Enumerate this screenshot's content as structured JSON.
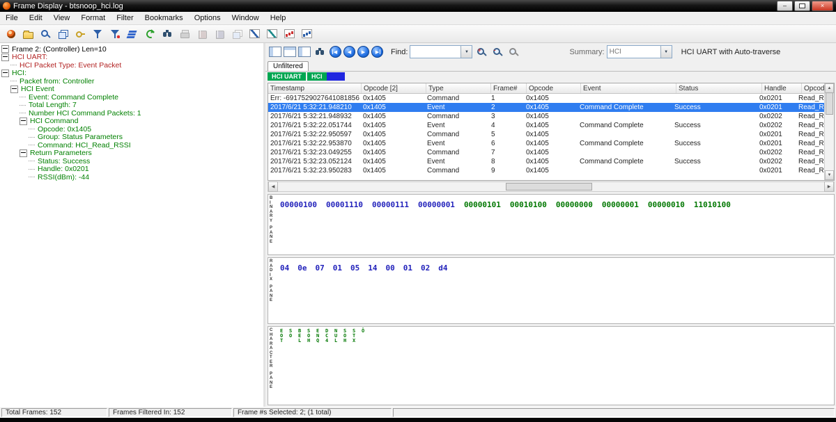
{
  "window": {
    "title": "Frame Display - btsnoop_hci.log"
  },
  "menu_bar": {
    "items": [
      "File",
      "Edit",
      "View",
      "Format",
      "Filter",
      "Bookmarks",
      "Options",
      "Window",
      "Help"
    ]
  },
  "main_toolbar": {
    "icons": [
      {
        "name": "starburst-icon",
        "shape": "burst",
        "color": "#e8641e"
      },
      {
        "name": "open-folder-icon",
        "shape": "folder",
        "color": "#f2c94c"
      },
      {
        "name": "magnifier-page-icon",
        "shape": "mag",
        "color": "#2d5fa8"
      },
      {
        "name": "overlapping-windows-icon",
        "shape": "windows",
        "color": "#2d5fa8"
      },
      {
        "name": "key-icon",
        "shape": "key",
        "color": "#c9a227"
      },
      {
        "name": "filter-funnel-icon",
        "shape": "funnel",
        "color": "#2d5fa8"
      },
      {
        "name": "filter-funnel-plus-icon",
        "shape": "funnel2",
        "color": "#2d5fa8"
      },
      {
        "name": "layers-icon",
        "shape": "layers",
        "color": "#3366cc"
      },
      {
        "name": "refresh-icon",
        "shape": "refresh",
        "color": "#2ca02c"
      },
      {
        "name": "binoculars-icon",
        "shape": "binoc",
        "color": "#2f4f6f"
      },
      {
        "name": "printer-icon",
        "shape": "printer",
        "color": "#b8b8b8",
        "disabled": true
      },
      {
        "name": "red-book-icon",
        "shape": "book",
        "color": "#c4b0b0",
        "disabled": true
      },
      {
        "name": "blue-book-icon",
        "shape": "book",
        "color": "#b0b0c4",
        "disabled": true
      },
      {
        "name": "gray-windows-icon",
        "shape": "windows",
        "color": "#9a9a9a",
        "disabled": true
      },
      {
        "name": "line-chart-icon",
        "shape": "chartline",
        "color": "#2d5fa8"
      },
      {
        "name": "teal-chart-icon",
        "shape": "chartline",
        "color": "#1f8a8a"
      },
      {
        "name": "red-bar-chart-icon",
        "shape": "chartbars",
        "color": "#cc3333"
      },
      {
        "name": "blue-bar-chart-icon",
        "shape": "chartbars",
        "color": "#2d5fa8"
      }
    ]
  },
  "decode_tree": {
    "items": [
      {
        "label": "Frame 2: (Controller) Len=10",
        "depth": 0,
        "box": true,
        "color": "#000000"
      },
      {
        "label": "HCI UART:",
        "depth": 0,
        "box": true,
        "color": "#b22222"
      },
      {
        "label": "HCI Packet Type: Event Packet",
        "depth": 1,
        "box": false,
        "color": "#b22222"
      },
      {
        "label": "HCI:",
        "depth": 0,
        "box": true,
        "color": "#008000"
      },
      {
        "label": "Packet from: Controller",
        "depth": 1,
        "box": false,
        "color": "#008000"
      },
      {
        "label": "HCI Event",
        "depth": 1,
        "box": true,
        "color": "#008000"
      },
      {
        "label": "Event: Command Complete",
        "depth": 2,
        "box": false,
        "color": "#008000"
      },
      {
        "label": "Total Length: 7",
        "depth": 2,
        "box": false,
        "color": "#008000"
      },
      {
        "label": "Number HCI Command Packets: 1",
        "depth": 2,
        "box": false,
        "color": "#008000"
      },
      {
        "label": "HCI Command",
        "depth": 2,
        "box": true,
        "color": "#008000"
      },
      {
        "label": "Opcode: 0x1405",
        "depth": 3,
        "box": false,
        "color": "#008000"
      },
      {
        "label": "Group: Status Parameters",
        "depth": 3,
        "box": false,
        "color": "#008000"
      },
      {
        "label": "Command: HCI_Read_RSSI",
        "depth": 3,
        "box": false,
        "color": "#008000"
      },
      {
        "label": "Return Parameters",
        "depth": 2,
        "box": true,
        "color": "#008000"
      },
      {
        "label": "Status: Success",
        "depth": 3,
        "box": false,
        "color": "#008000"
      },
      {
        "label": "Handle: 0x0201",
        "depth": 3,
        "box": false,
        "color": "#008000"
      },
      {
        "label": "RSSI(dBm): -44",
        "depth": 3,
        "box": false,
        "color": "#008000"
      }
    ]
  },
  "frame_toolbar": {
    "pane_toggle_icons": [
      "single-pane-icon",
      "two-pane-icon",
      "three-pane-icon"
    ],
    "nav_buttons": [
      {
        "name": "first-frame-button",
        "dir": "first"
      },
      {
        "name": "previous-frame-button",
        "dir": "prev"
      },
      {
        "name": "next-frame-button",
        "dir": "next"
      },
      {
        "name": "last-frame-button",
        "dir": "last"
      }
    ],
    "zoom_icons": [
      {
        "name": "zoom-in-icon",
        "sign": "+"
      },
      {
        "name": "zoom-out-icon",
        "sign": "-"
      },
      {
        "name": "zoom-reset-icon",
        "sign": ""
      }
    ],
    "find_label": "Find:",
    "find_value": "",
    "summary_label": "Summary:",
    "summary_value": "HCI",
    "mode_title": "HCI UART with Auto-traverse"
  },
  "filter_tabs": {
    "unfiltered": "Unfiltered",
    "hci_uart": "HCI UART",
    "hci": "HCI"
  },
  "table": {
    "columns": [
      "Timestamp",
      "Opcode [2]",
      "Type",
      "Frame#",
      "Opcode",
      "Event",
      "Status",
      "Handle",
      "Opcode Command"
    ],
    "selected_row_index": 1,
    "rows": [
      [
        "Err: -6917529027641081856",
        "0x1405",
        "Command",
        "1",
        "0x1405",
        "",
        "",
        "0x0201",
        "Read_RSSI"
      ],
      [
        "2017/6/21 5:32:21.948210",
        "0x1405",
        "Event",
        "2",
        "0x1405",
        "Command Complete",
        "Success",
        "0x0201",
        "Read_RSSI"
      ],
      [
        "2017/6/21 5:32:21.948932",
        "0x1405",
        "Command",
        "3",
        "0x1405",
        "",
        "",
        "0x0202",
        "Read_RSSI"
      ],
      [
        "2017/6/21 5:32:22.051744",
        "0x1405",
        "Event",
        "4",
        "0x1405",
        "Command Complete",
        "Success",
        "0x0202",
        "Read_RSSI"
      ],
      [
        "2017/6/21 5:32:22.950597",
        "0x1405",
        "Command",
        "5",
        "0x1405",
        "",
        "",
        "0x0201",
        "Read_RSSI"
      ],
      [
        "2017/6/21 5:32:22.953870",
        "0x1405",
        "Event",
        "6",
        "0x1405",
        "Command Complete",
        "Success",
        "0x0201",
        "Read_RSSI"
      ],
      [
        "2017/6/21 5:32:23.049255",
        "0x1405",
        "Command",
        "7",
        "0x1405",
        "",
        "",
        "0x0202",
        "Read_RSSI"
      ],
      [
        "2017/6/21 5:32:23.052124",
        "0x1405",
        "Event",
        "8",
        "0x1405",
        "Command Complete",
        "Success",
        "0x0202",
        "Read_RSSI"
      ],
      [
        "2017/6/21 5:32:23.950283",
        "0x1405",
        "Command",
        "9",
        "0x1405",
        "",
        "",
        "0x0201",
        "Read_RSSI"
      ]
    ]
  },
  "binary_pane": {
    "label": "BINARY PANE",
    "groups": [
      "00000100",
      "00001110",
      "00000111",
      "00000001",
      "00000101",
      "00010100",
      "00000000",
      "00000001",
      "00000010",
      "11010100"
    ],
    "group_colors": [
      "#2222bb",
      "#2222bb",
      "#2222bb",
      "#2222bb",
      "#007700",
      "#007700",
      "#007700",
      "#007700",
      "#007700",
      "#007700"
    ]
  },
  "radix_pane": {
    "label": "RADIX PANE",
    "bytes": [
      "04",
      "0e",
      "07",
      "01",
      "05",
      "14",
      "00",
      "01",
      "02",
      "d4"
    ],
    "color": "#2222bb"
  },
  "character_pane": {
    "label": "CHARACTER PANE",
    "columns": [
      "EOT",
      "SO",
      "BEL",
      "SOH",
      "ENQ",
      "DC4",
      "NUL",
      "SOH",
      "STX",
      "Ô"
    ],
    "color": "#007700"
  },
  "status_bar": {
    "total": "Total Frames:  152",
    "filtered": "Frames Filtered In:  152",
    "selected": "Frame #s Selected:   2; (1 total)"
  }
}
